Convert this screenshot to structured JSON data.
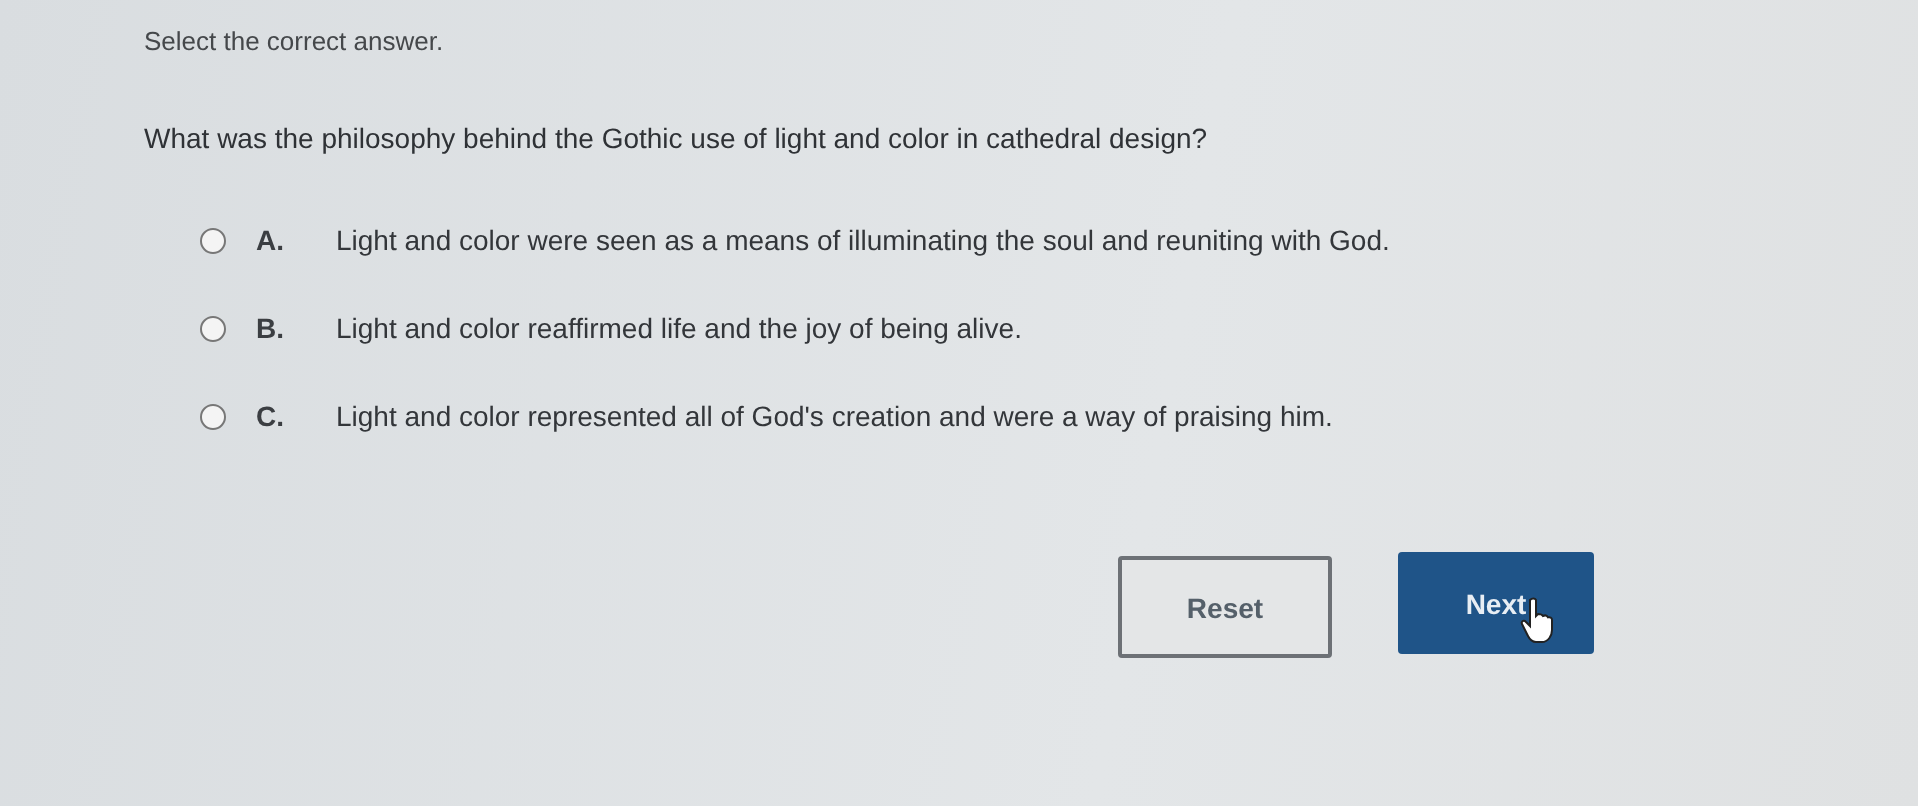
{
  "instruction": "Select the correct answer.",
  "question": "What was the philosophy behind the Gothic use of light and color in cathedral design?",
  "options": [
    {
      "letter": "A.",
      "text": "Light and color were seen as a means of illuminating the soul and reuniting with God.",
      "selected": false
    },
    {
      "letter": "B.",
      "text": "Light and color reaffirmed life and the joy of being alive.",
      "selected": false
    },
    {
      "letter": "C.",
      "text": "Light and color represented all of God's creation and were a way of praising him.",
      "selected": false
    }
  ],
  "buttons": [
    {
      "label": "Reset",
      "kind": "outline"
    },
    {
      "label": "Next",
      "kind": "primary"
    }
  ]
}
